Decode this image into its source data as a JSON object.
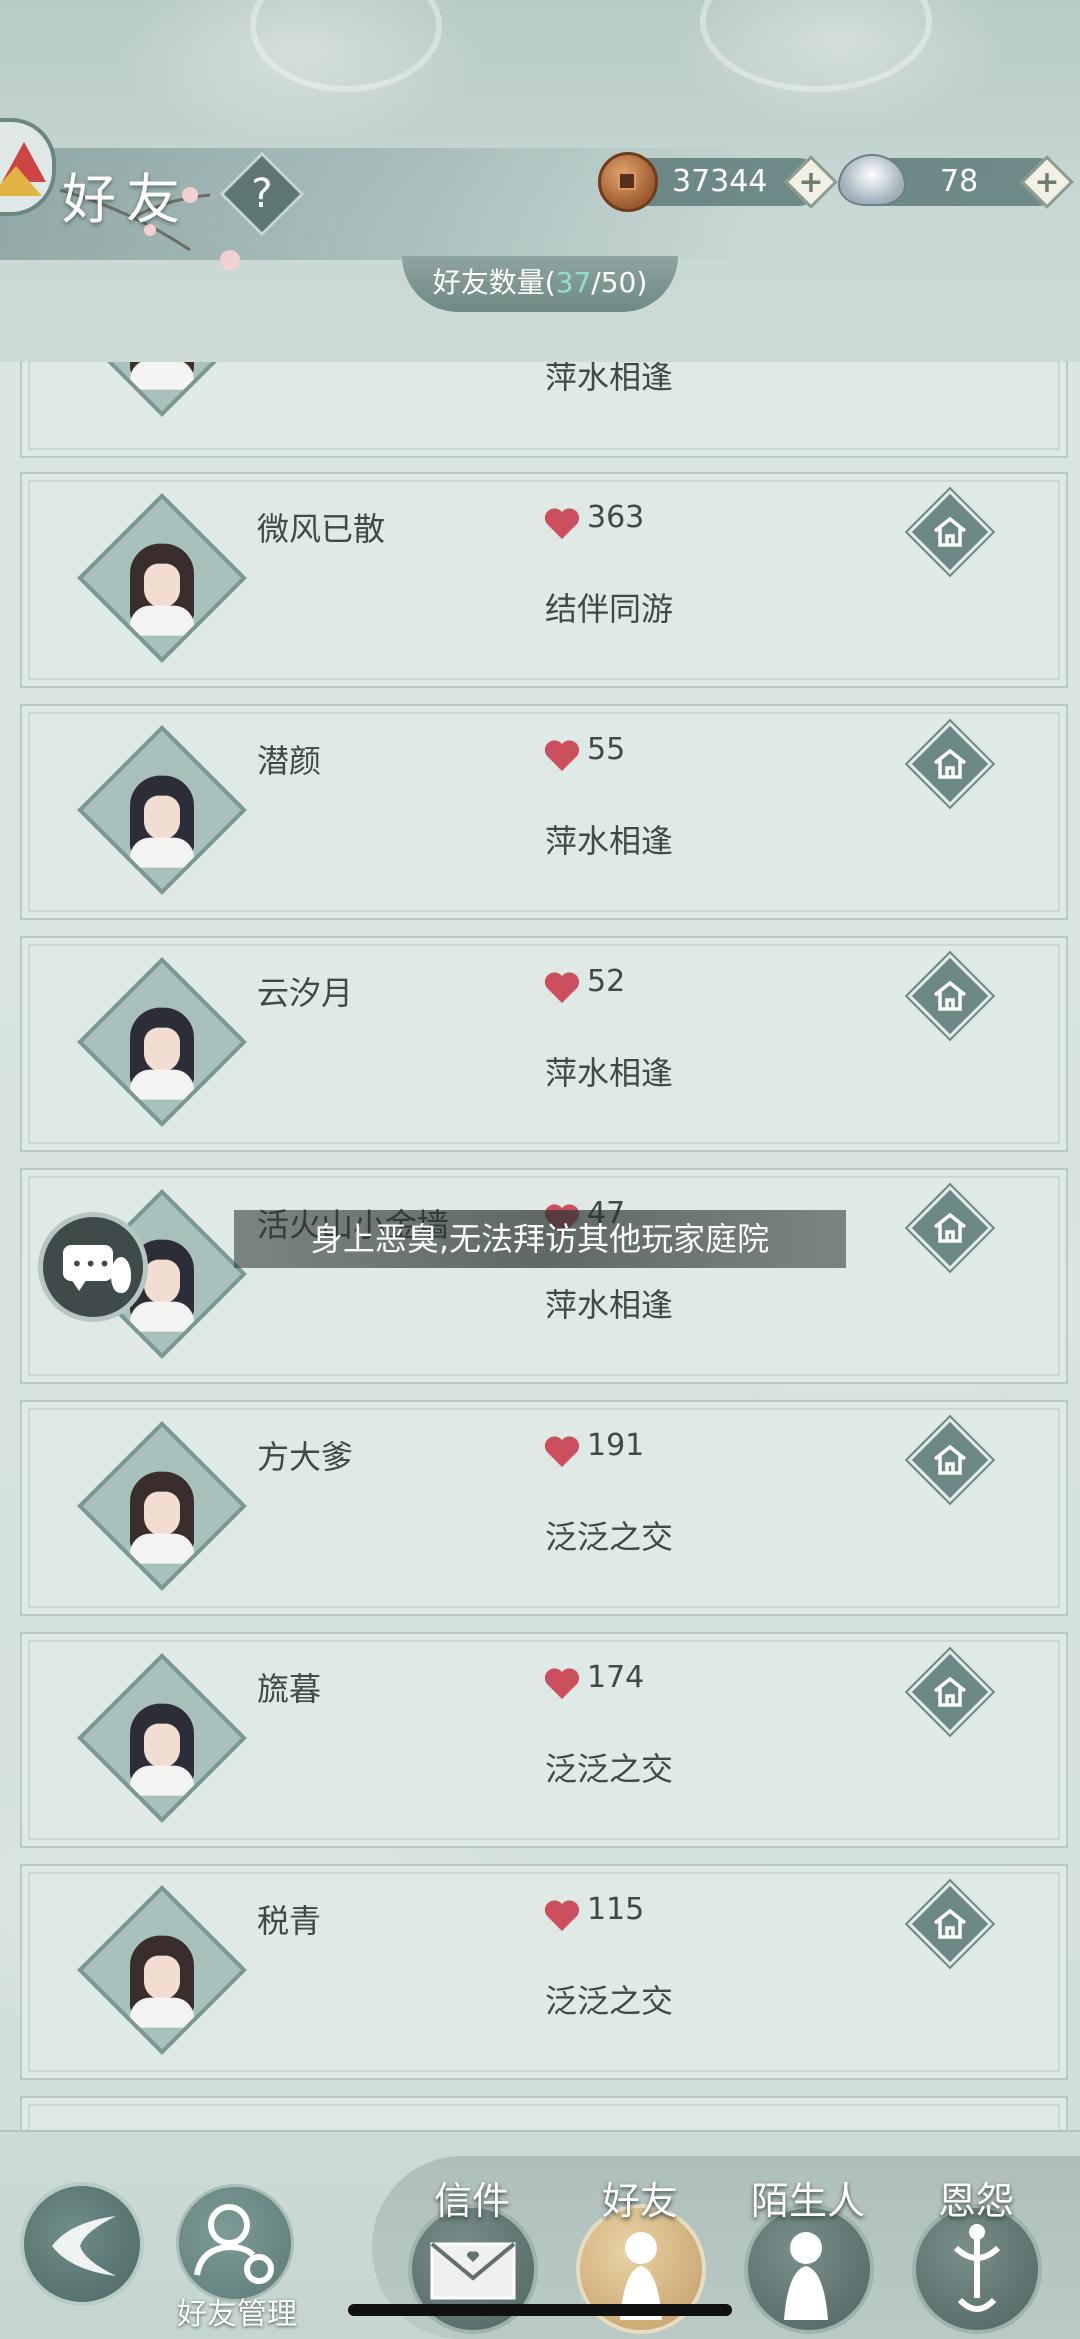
{
  "header": {
    "title": "好友",
    "help_label": "?",
    "coins": "37344",
    "silver": "78",
    "plus": "+",
    "friend_count_label": "好友数量",
    "friend_count_current": "37",
    "friend_count_max": "50"
  },
  "partial_top_relation": "萍水相逢",
  "friends": [
    {
      "name": "微风已散",
      "affinity": "363",
      "relation": "结伴同游"
    },
    {
      "name": "潜颜",
      "affinity": "55",
      "relation": "萍水相逢"
    },
    {
      "name": "云汐月",
      "affinity": "52",
      "relation": "萍水相逢"
    },
    {
      "name": "活火山小金墙",
      "affinity": "47",
      "relation": "萍水相逢"
    },
    {
      "name": "方大爹",
      "affinity": "191",
      "relation": "泛泛之交"
    },
    {
      "name": "旒暮",
      "affinity": "174",
      "relation": "泛泛之交"
    },
    {
      "name": "税青",
      "affinity": "115",
      "relation": "泛泛之交"
    }
  ],
  "toast": "身上恶臭,无法拜访其他玩家庭院",
  "bottom": {
    "manage_label": "好友管理",
    "tabs": [
      {
        "label": "信件"
      },
      {
        "label": "好友"
      },
      {
        "label": "陌生人"
      },
      {
        "label": "恩怨"
      }
    ]
  },
  "colors": {
    "heart": "#c9505c",
    "accent_count": "#8fe2c8",
    "active_tab": "#c29c63"
  }
}
